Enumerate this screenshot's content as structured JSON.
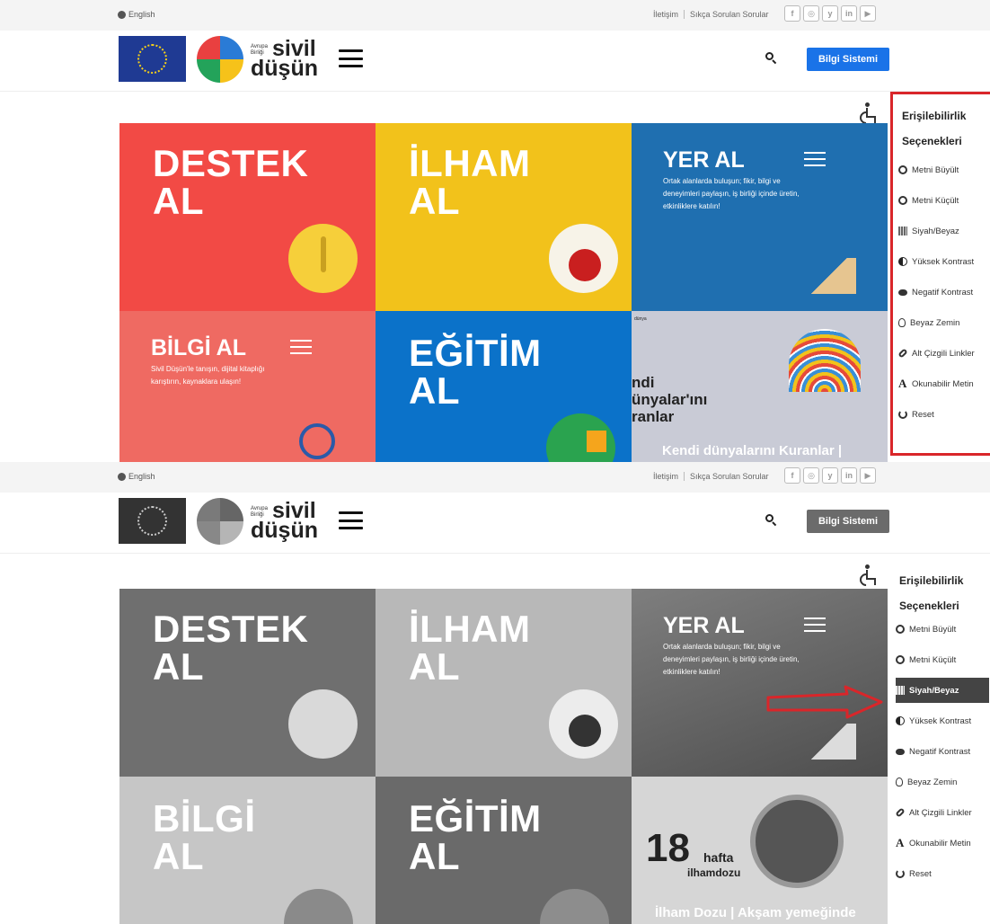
{
  "topbar": {
    "language": "English",
    "links": [
      "İletişim",
      "Sıkça Sorulan Sorular"
    ],
    "socials": [
      "f",
      "◎",
      "y",
      "in",
      "▶"
    ]
  },
  "header": {
    "brand_small": "Avrupa Birliği",
    "brand_line1": "sivil",
    "brand_line2": "düşün",
    "cta": "Bilgi Sistemi"
  },
  "tiles_color": {
    "destek": "DESTEK\nAL",
    "ilham": "İLHAM\nAL",
    "yer_title": "YER AL",
    "yer_desc": "Ortak alanlarda buluşun; fikir, bilgi ve deneyimleri paylaşın, iş birliği içinde üretin, etkinliklere katılın!",
    "bilgi_title": "BİLGİ AL",
    "bilgi_desc": "Sivil Düşün'le tanışın, dijital kitaplığı karıştırın, kaynaklara ulaşın!",
    "egitim": "EĞİTİM\nAL",
    "news_mini": "dünya",
    "news_partial": "ndi\nünyalar'ını\nranlar",
    "news_caption": "Kendi dünyalarını Kuranlar |"
  },
  "tiles_gray": {
    "destek": "DESTEK\nAL",
    "ilham": "İLHAM\nAL",
    "yer_title": "YER AL",
    "yer_desc": "Ortak alanlarda buluşun; fikir, bilgi ve deneyimleri paylaşın, iş birliği içinde üretin, etkinliklere katılın!",
    "bilgi": "BİLGİ\nAL",
    "egitim": "EĞİTİM\nAL",
    "hafta_num": "18",
    "hafta_word": "hafta",
    "ilham_dozu": "ilhamdozu",
    "news_caption": "İlham Dozu | Akşam yemeğinde"
  },
  "panel": {
    "title": "Erişilebilirlik Seçenekleri",
    "options": [
      {
        "label": "Metni Büyült",
        "icon": "zoom-in-icon"
      },
      {
        "label": "Metni Küçült",
        "icon": "zoom-out-icon"
      },
      {
        "label": "Siyah/Beyaz",
        "icon": "grayscale-icon"
      },
      {
        "label": "Yüksek Kontrast",
        "icon": "contrast-icon"
      },
      {
        "label": "Negatif Kontrast",
        "icon": "eye-icon"
      },
      {
        "label": "Beyaz Zemin",
        "icon": "lightbulb-icon"
      },
      {
        "label": "Alt Çizgili Linkler",
        "icon": "link-icon"
      },
      {
        "label": "Okunabilir Metin",
        "icon": "font-icon"
      },
      {
        "label": "Reset",
        "icon": "reset-icon"
      }
    ],
    "active_in_gray": "Siyah/Beyaz"
  },
  "colors": {
    "destek": "#f24a45",
    "ilham": "#f2c21b",
    "yer": "#1f6fb0",
    "bilgi": "#ef6a62",
    "egitim": "#0b72c9",
    "news": "#c9cbd6",
    "cta": "#1a73e8",
    "highlight_border": "#d9262a",
    "arrow": "#d9262a"
  }
}
